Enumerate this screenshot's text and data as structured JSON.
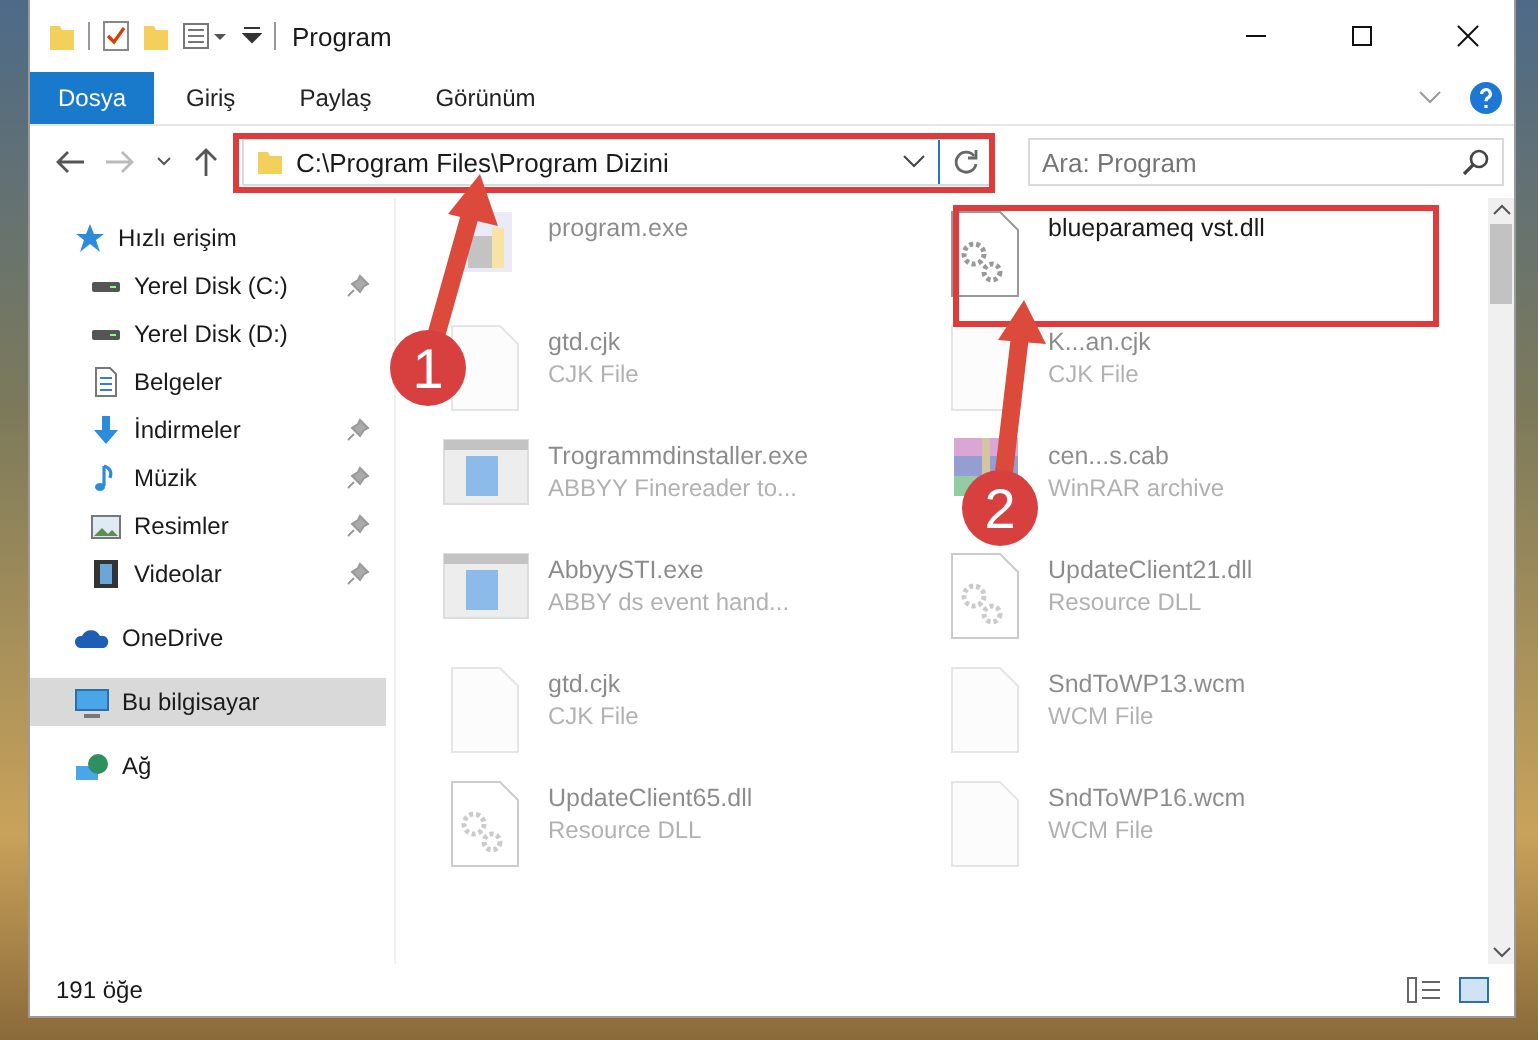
{
  "window": {
    "title": "Program"
  },
  "ribbon_tabs": [
    {
      "label": "Dosya",
      "kind": "file"
    },
    {
      "label": "Giriş",
      "kind": "tab"
    },
    {
      "label": "Paylaş",
      "kind": "tab"
    },
    {
      "label": "Görünüm",
      "kind": "tab"
    }
  ],
  "address_bar": {
    "path": "C:\\Program Files\\Program Dizini"
  },
  "search": {
    "placeholder": "Ara: Program"
  },
  "sidebar": {
    "items": [
      {
        "label": "Hızlı erişim",
        "kind": "star",
        "selected": false,
        "children": [
          {
            "label": "Yerel Disk (C:)",
            "kind": "drive",
            "pinned": true,
            "selected": false
          },
          {
            "label": "Yerel Disk (D:)",
            "kind": "drive",
            "pinned": false,
            "selected": false
          },
          {
            "label": "Belgeler",
            "kind": "docs",
            "pinned": false,
            "selected": false
          },
          {
            "label": "İndirmeler",
            "kind": "download",
            "pinned": true,
            "selected": false
          },
          {
            "label": "Müzik",
            "kind": "music",
            "pinned": true,
            "selected": false
          },
          {
            "label": "Resimler",
            "kind": "pictures",
            "pinned": true,
            "selected": false
          },
          {
            "label": "Videolar",
            "kind": "video",
            "pinned": true,
            "selected": false
          }
        ]
      },
      {
        "label": "OneDrive",
        "kind": "cloud",
        "selected": false
      },
      {
        "label": "Bu bilgisayar",
        "kind": "pc",
        "selected": true
      },
      {
        "label": "Ağ",
        "kind": "network",
        "selected": false
      }
    ]
  },
  "files": [
    {
      "name": "program.exe",
      "kind": "installer",
      "faded": true
    },
    {
      "name": "blueparameq vst.dll",
      "kind": "dll",
      "faded": false
    },
    {
      "name": "gtd.cjk",
      "type": "CJK File",
      "kind": "blank",
      "faded": true
    },
    {
      "name": "K...an.cjk",
      "type": "CJK File",
      "kind": "blank",
      "faded": true
    },
    {
      "name": "Trogrammdinstaller.exe",
      "type": "ABBYY Finereader to...",
      "kind": "app",
      "faded": true
    },
    {
      "name": "cen...s.cab",
      "type": "WinRAR archive",
      "kind": "archive",
      "faded": true
    },
    {
      "name": "AbbyySTI.exe",
      "type": "ABBY ds event hand...",
      "kind": "app",
      "faded": true
    },
    {
      "name": "UpdateClient21.dll",
      "type": "Resource DLL",
      "kind": "dll",
      "faded": true
    },
    {
      "name": "gtd.cjk",
      "type": "CJK File",
      "kind": "blank",
      "faded": true
    },
    {
      "name": "SndToWP13.wcm",
      "type": "WCM File",
      "kind": "blank",
      "faded": true
    },
    {
      "name": "UpdateClient65.dll",
      "type": "Resource DLL",
      "kind": "dll",
      "faded": true
    },
    {
      "name": "SndToWP16.wcm",
      "type": "WCM File",
      "kind": "blank",
      "faded": true
    }
  ],
  "status_bar": {
    "item_count": "191 öğe"
  },
  "annotations": [
    {
      "label": "1"
    },
    {
      "label": "2"
    }
  ]
}
